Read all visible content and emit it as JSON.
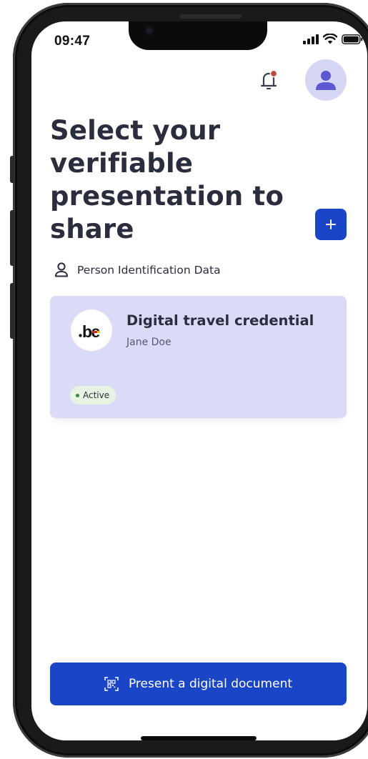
{
  "status_bar": {
    "time": "09:47",
    "icons": [
      "signal-icon",
      "wifi-icon",
      "battery-icon"
    ]
  },
  "header": {
    "notification_icon": "bell-icon",
    "notification_dot_color": "#c0473a",
    "avatar_icon": "user-icon"
  },
  "page": {
    "title": "Select your verifiable presentation to share",
    "add_icon": "plus-icon"
  },
  "category": {
    "icon": "person-icon",
    "label": "Person Identification Data"
  },
  "credential": {
    "title": "Digital travel credential",
    "holder": "Jane Doe",
    "issuer_logo_text": ".be",
    "status": "Active",
    "status_color": "#3a8a3a"
  },
  "actions": {
    "present_label": "Present a digital document",
    "present_icon": "qr-scan-icon"
  },
  "colors": {
    "primary": "#1a45c6",
    "card_bg": "#d9dbf7",
    "text": "#2a2d3e",
    "avatar_bg": "#d6d6f5"
  }
}
